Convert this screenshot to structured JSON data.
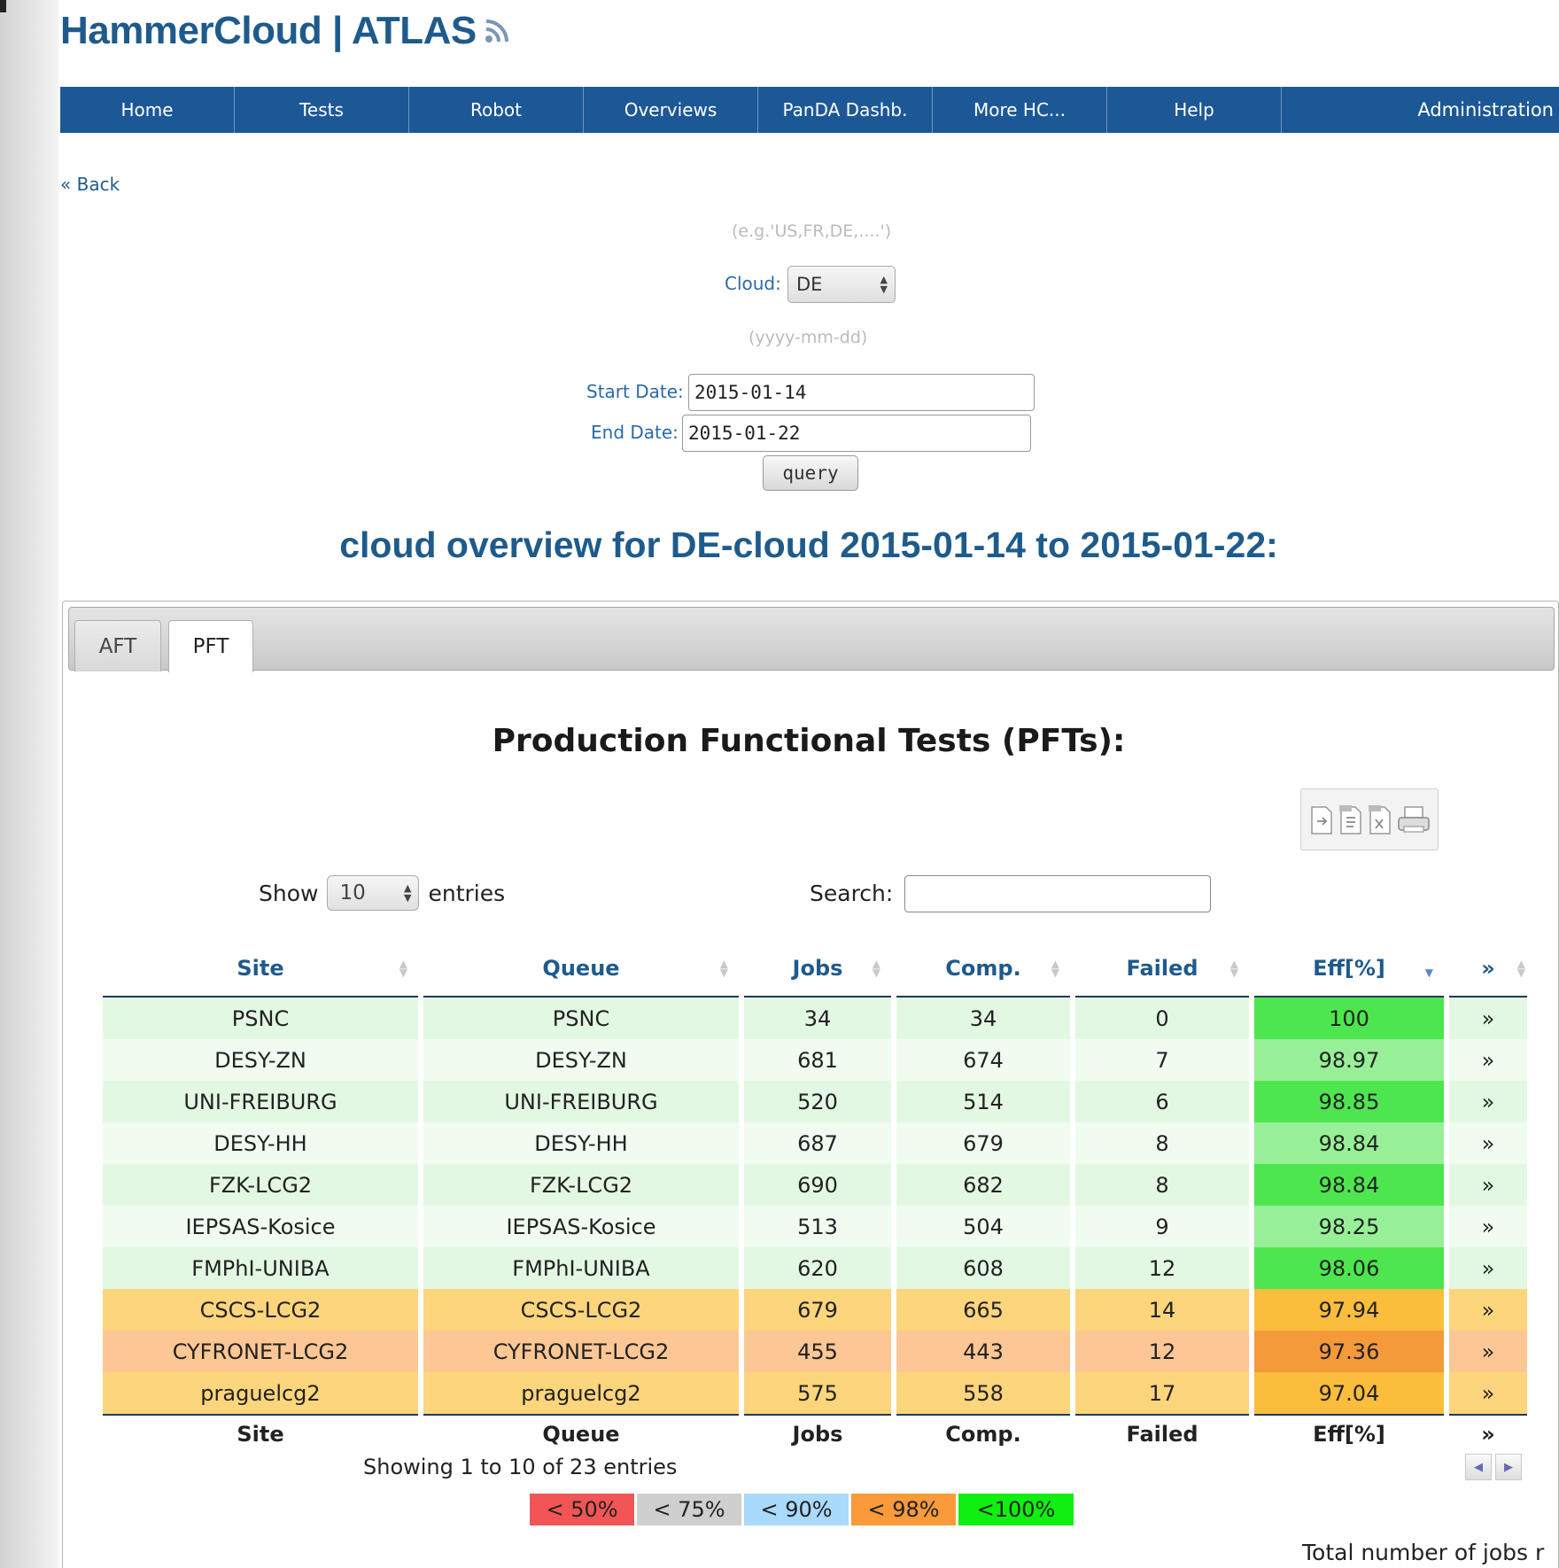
{
  "header": {
    "title": "HammerCloud | ATLAS",
    "feed_icon": "rss-icon"
  },
  "nav": {
    "items": [
      {
        "label": "Home"
      },
      {
        "label": "Tests"
      },
      {
        "label": "Robot"
      },
      {
        "label": "Overviews"
      },
      {
        "label": "PanDA Dashb."
      },
      {
        "label": "More HC..."
      },
      {
        "label": "Help"
      },
      {
        "label": "Administration"
      }
    ]
  },
  "back_link": "« Back",
  "form": {
    "cloud_hint": "(e.g.'US,FR,DE,....')",
    "cloud_label": "Cloud:",
    "cloud_value": "DE",
    "date_hint": "(yyyy-mm-dd)",
    "start_label": "Start Date:",
    "start_value": "2015-01-14",
    "end_label": "End Date:",
    "end_value": "2015-01-22",
    "query_button": "query"
  },
  "overview_title": "cloud overview for DE-cloud 2015-01-14 to 2015-01-22:",
  "tabs": [
    {
      "label": "AFT",
      "active": false
    },
    {
      "label": "PFT",
      "active": true
    }
  ],
  "section_title": "Production Functional Tests (PFTs):",
  "export_icons": [
    "copy-icon",
    "csv-icon",
    "xls-icon",
    "print-icon"
  ],
  "table_controls": {
    "show_label": "Show",
    "page_size": "10",
    "entries_label": "entries",
    "search_label": "Search:",
    "search_value": ""
  },
  "table": {
    "columns": [
      "Site",
      "Queue",
      "Jobs",
      "Comp.",
      "Failed",
      "Eff[%]",
      "»"
    ],
    "sorted_column": "Eff[%]",
    "rows": [
      {
        "site": "PSNC",
        "queue": "PSNC",
        "jobs": "34",
        "comp": "34",
        "failed": "0",
        "eff": "100",
        "link": "»",
        "row_color": "#e3f8e3",
        "eff_color": "#4ee64e"
      },
      {
        "site": "DESY-ZN",
        "queue": "DESY-ZN",
        "jobs": "681",
        "comp": "674",
        "failed": "7",
        "eff": "98.97",
        "link": "»",
        "row_color": "#f0fcf0",
        "eff_color": "#97f097"
      },
      {
        "site": "UNI-FREIBURG",
        "queue": "UNI-FREIBURG",
        "jobs": "520",
        "comp": "514",
        "failed": "6",
        "eff": "98.85",
        "link": "»",
        "row_color": "#e3f8e3",
        "eff_color": "#4ee64e"
      },
      {
        "site": "DESY-HH",
        "queue": "DESY-HH",
        "jobs": "687",
        "comp": "679",
        "failed": "8",
        "eff": "98.84",
        "link": "»",
        "row_color": "#f0fcf0",
        "eff_color": "#97f097"
      },
      {
        "site": "FZK-LCG2",
        "queue": "FZK-LCG2",
        "jobs": "690",
        "comp": "682",
        "failed": "8",
        "eff": "98.84",
        "link": "»",
        "row_color": "#e3f8e3",
        "eff_color": "#4ee64e"
      },
      {
        "site": "IEPSAS-Kosice",
        "queue": "IEPSAS-Kosice",
        "jobs": "513",
        "comp": "504",
        "failed": "9",
        "eff": "98.25",
        "link": "»",
        "row_color": "#f0fcf0",
        "eff_color": "#97f097"
      },
      {
        "site": "FMPhI-UNIBA",
        "queue": "FMPhI-UNIBA",
        "jobs": "620",
        "comp": "608",
        "failed": "12",
        "eff": "98.06",
        "link": "»",
        "row_color": "#e3f8e3",
        "eff_color": "#4ee64e"
      },
      {
        "site": "CSCS-LCG2",
        "queue": "CSCS-LCG2",
        "jobs": "679",
        "comp": "665",
        "failed": "14",
        "eff": "97.94",
        "link": "»",
        "row_color": "#fdd57c",
        "eff_color": "#fbbd3c"
      },
      {
        "site": "CYFRONET-LCG2",
        "queue": "CYFRONET-LCG2",
        "jobs": "455",
        "comp": "443",
        "failed": "12",
        "eff": "97.36",
        "link": "»",
        "row_color": "#fcc794",
        "eff_color": "#f59a3a"
      },
      {
        "site": "praguelcg2",
        "queue": "praguelcg2",
        "jobs": "575",
        "comp": "558",
        "failed": "17",
        "eff": "97.04",
        "link": "»",
        "row_color": "#fdd57c",
        "eff_color": "#fbbd3c"
      }
    ]
  },
  "info_text": "Showing 1 to 10 of 23 entries",
  "pager": {
    "prev_icon": "prev-arrow-icon",
    "next_icon": "next-arrow-icon"
  },
  "legend": [
    {
      "label": "< 50%",
      "color": "#f25555"
    },
    {
      "label": "< 75%",
      "color": "#cfcfcf"
    },
    {
      "label": "< 90%",
      "color": "#a9d9fb"
    },
    {
      "label": "< 98%",
      "color": "#fb9a3a"
    },
    {
      "label": "<100%",
      "color": "#11ee11"
    }
  ],
  "total_text": "Total number of jobs r"
}
